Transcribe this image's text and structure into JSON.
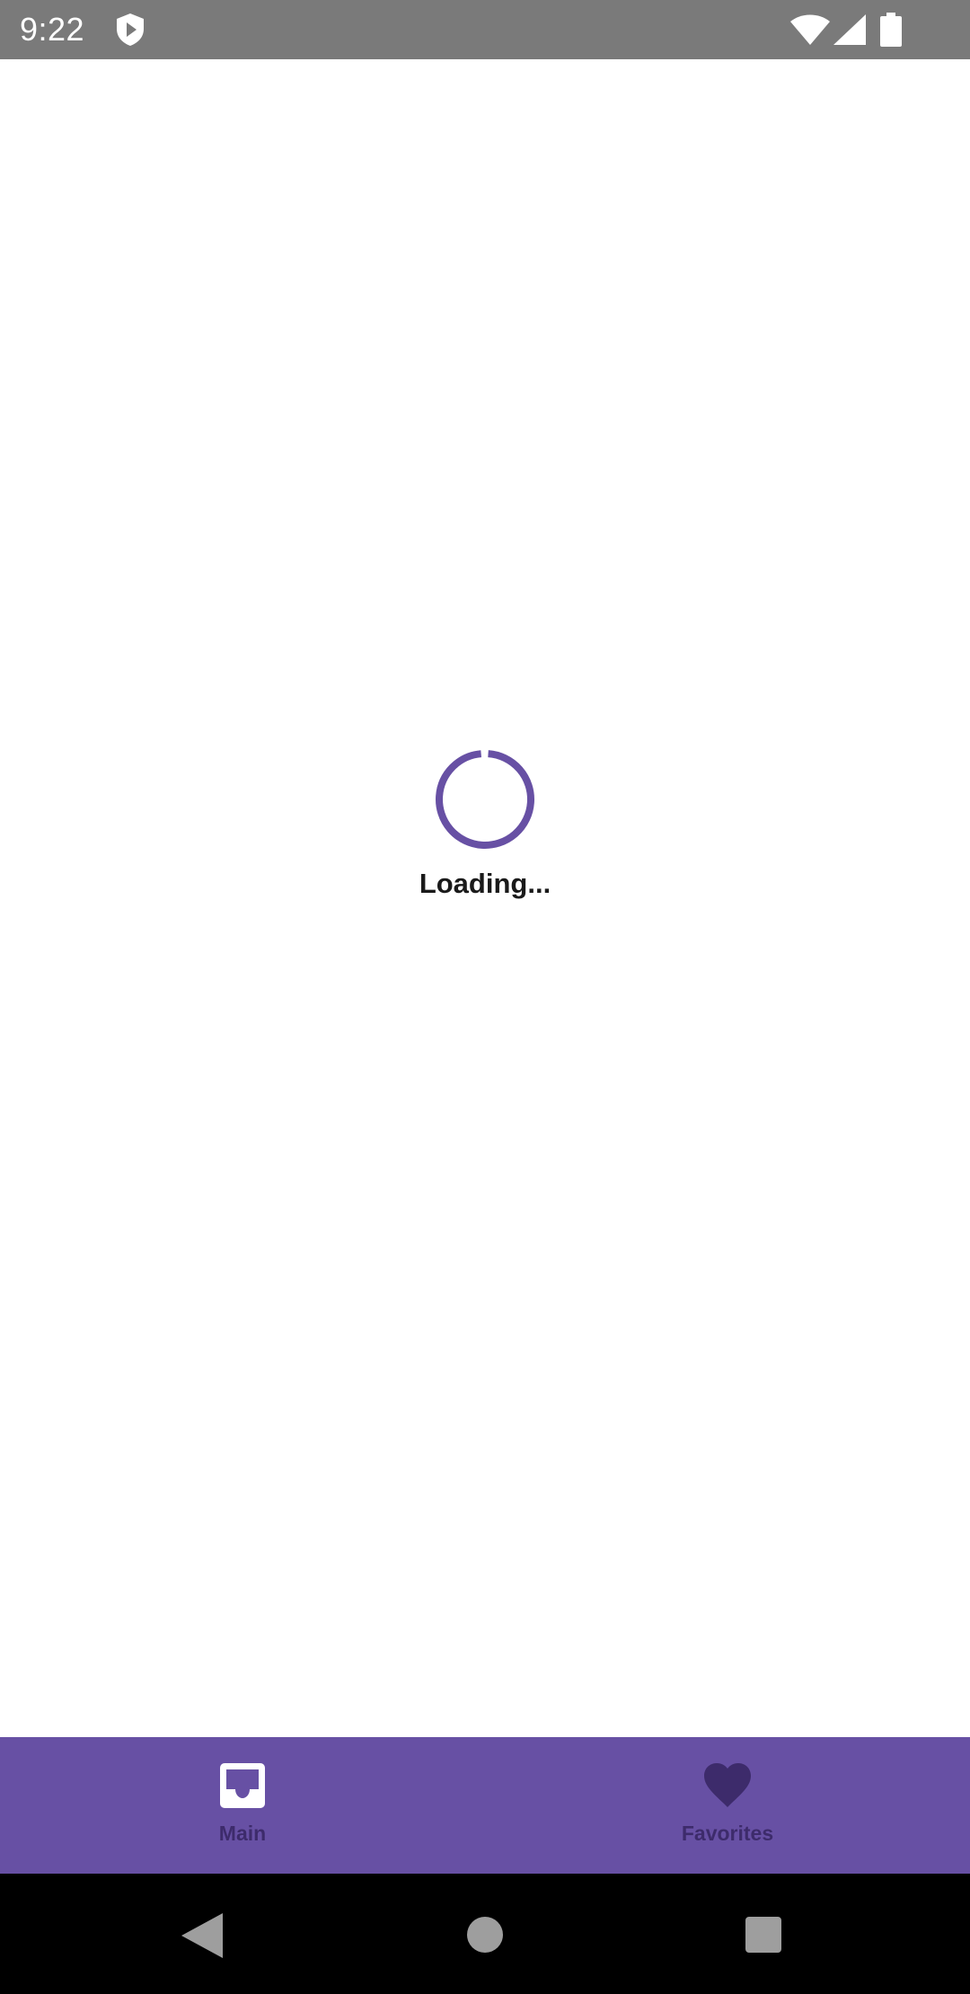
{
  "status_bar": {
    "time": "9:22",
    "icons": [
      "shield-icon",
      "wifi-icon",
      "signal-icon",
      "battery-icon"
    ],
    "background": "#7a7a7a"
  },
  "content": {
    "loading_text": "Loading...",
    "spinner_color": "#6750a4"
  },
  "bottom_nav": {
    "background": "#6750a4",
    "items": [
      {
        "label": "Main",
        "icon": "inbox-icon",
        "color": "#ffffff",
        "selected": true
      },
      {
        "label": "Favorites",
        "icon": "heart-icon",
        "color": "#3d2b6b",
        "selected": false
      }
    ]
  },
  "system_nav": {
    "buttons": [
      "back-icon",
      "home-icon",
      "recents-icon"
    ]
  }
}
